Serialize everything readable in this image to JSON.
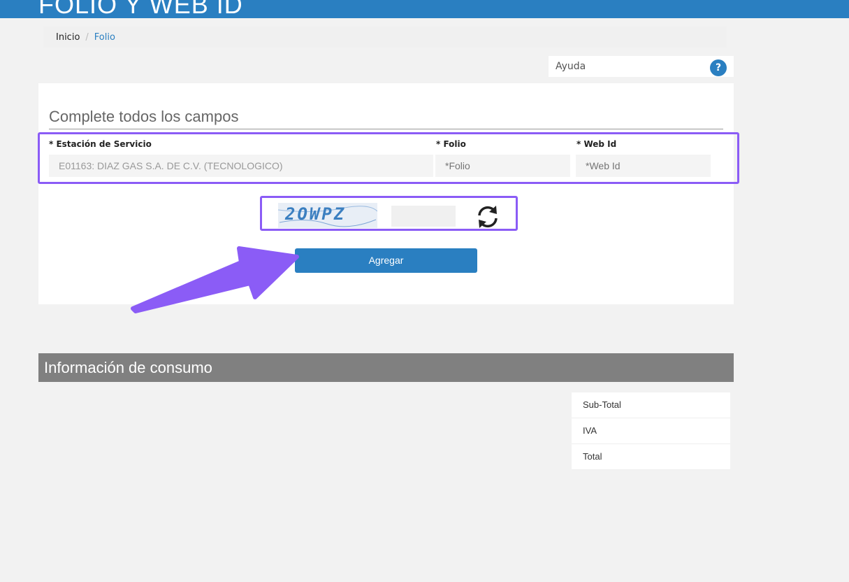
{
  "header": {
    "title": "FOLIO Y WEB ID",
    "color": "#2a7fc1"
  },
  "breadcrumb": {
    "home": "Inicio",
    "separator": "/",
    "current": "Folio"
  },
  "help": {
    "label": "Ayuda",
    "icon": "?"
  },
  "form": {
    "title": "Complete todos los campos",
    "station": {
      "label": "* Estación de Servicio",
      "value": "E01163: DIAZ GAS S.A. DE C.V. (TECNOLOGICO)"
    },
    "folio": {
      "label": "* Folio",
      "placeholder": "*Folio"
    },
    "webid": {
      "label": "* Web Id",
      "placeholder": "*Web Id"
    },
    "captcha": {
      "text": "2OWPZ",
      "input_value": ""
    },
    "submit_label": "Agregar"
  },
  "info": {
    "title": "Información de consumo",
    "totals": [
      {
        "label": "Sub-Total"
      },
      {
        "label": "IVA"
      },
      {
        "label": "Total"
      }
    ]
  },
  "colors": {
    "accent": "#2a7fc1",
    "highlight": "#8b5cf6",
    "section_header": "#808080"
  }
}
